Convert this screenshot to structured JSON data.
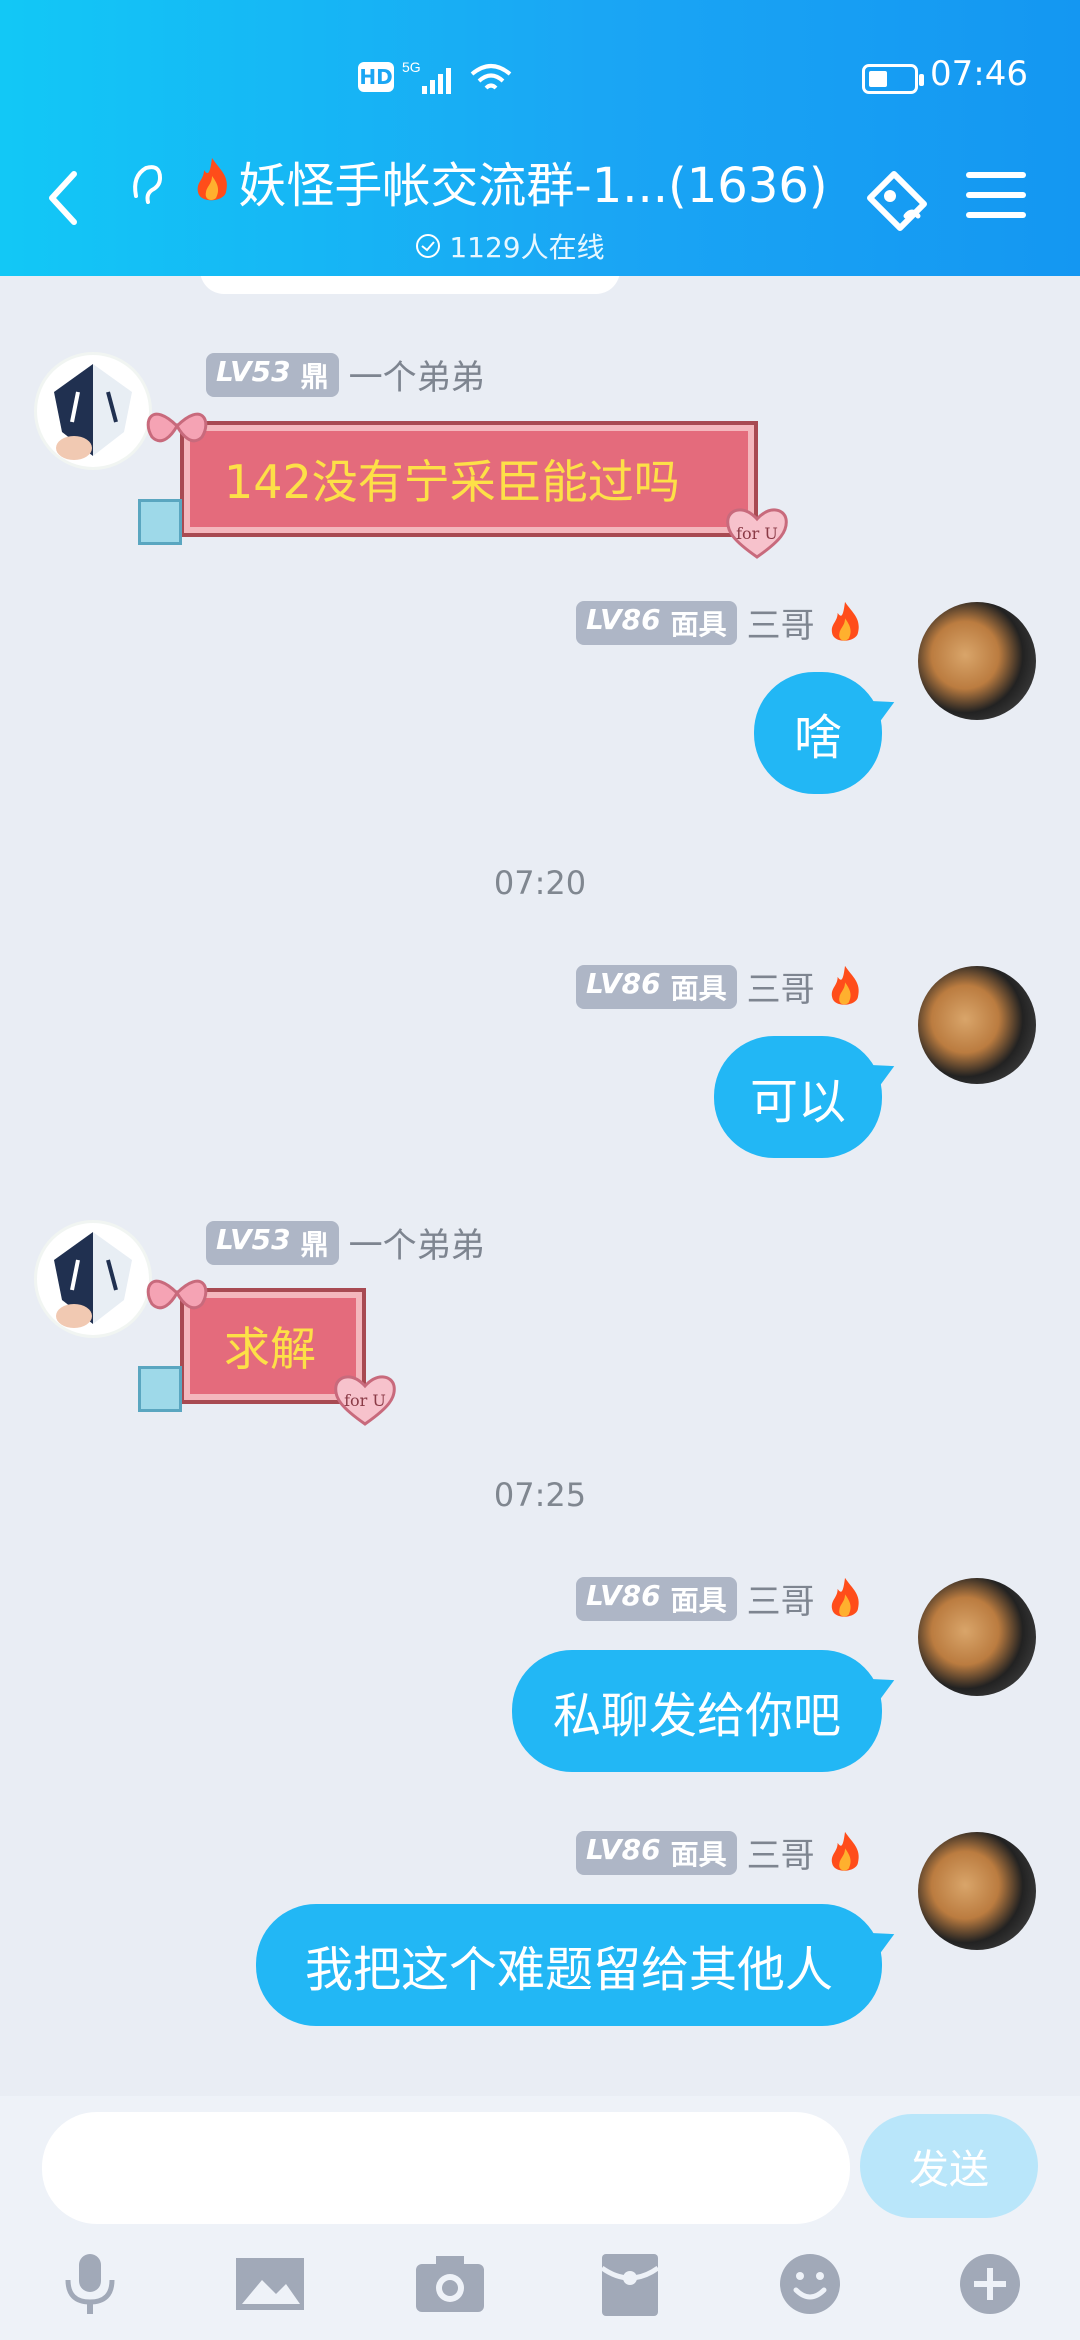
{
  "status_bar": {
    "hd_label": "HD",
    "network_label": "5G",
    "time": "07:46"
  },
  "header": {
    "title": "妖怪手帐交流群-1...(1636)",
    "online": "1129人在线"
  },
  "messages": [
    {
      "side": "left",
      "level": "LV53",
      "title": "鼎",
      "name": "一个弟弟",
      "type": "gift",
      "text": "142没有宁采臣能过吗"
    },
    {
      "side": "right",
      "level": "LV86",
      "title": "面具",
      "name": "三哥",
      "type": "text",
      "text": "啥"
    },
    {
      "type": "time",
      "text": "07:20"
    },
    {
      "side": "right",
      "level": "LV86",
      "title": "面具",
      "name": "三哥",
      "type": "text",
      "text": "可以"
    },
    {
      "side": "left",
      "level": "LV53",
      "title": "鼎",
      "name": "一个弟弟",
      "type": "gift",
      "text": "求解"
    },
    {
      "type": "time",
      "text": "07:25"
    },
    {
      "side": "right",
      "level": "LV86",
      "title": "面具",
      "name": "三哥",
      "type": "text",
      "text": "私聊发给你吧"
    },
    {
      "side": "right",
      "level": "LV86",
      "title": "面具",
      "name": "三哥",
      "type": "text",
      "text": "我把这个难题留给其他人"
    }
  ],
  "gift_tag": "for U",
  "composer": {
    "placeholder": "",
    "send_label": "发送"
  },
  "toolbar": [
    "microphone-icon",
    "image-icon",
    "camera-icon",
    "red-packet-icon",
    "emoji-icon",
    "plus-icon"
  ],
  "colors": {
    "header_start": "#12c8f6",
    "header_end": "#1497f2",
    "bubble": "#22b7f5",
    "gift_text": "#fde047"
  }
}
